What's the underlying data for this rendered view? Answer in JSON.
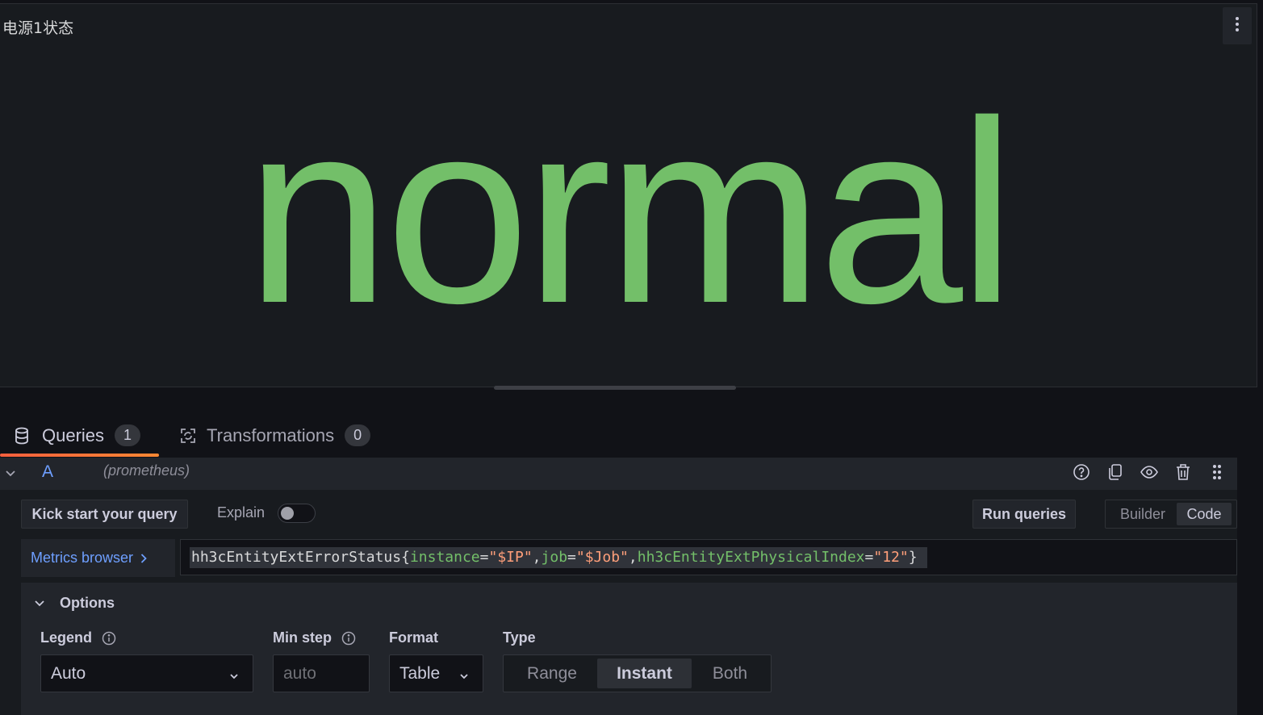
{
  "panel": {
    "title": "电源1状态",
    "value": "normal",
    "value_color": "#73bf69",
    "menu_icon": "kebab-vertical-icon"
  },
  "tabs": [
    {
      "label": "Queries",
      "count": "1",
      "icon": "database-icon",
      "active": true
    },
    {
      "label": "Transformations",
      "count": "0",
      "icon": "transform-icon",
      "active": false
    }
  ],
  "query": {
    "ref_id": "A",
    "datasource": "(prometheus)",
    "actions": [
      "help-icon",
      "duplicate-icon",
      "eye-icon",
      "trash-icon",
      "drag-handle-icon"
    ],
    "kick_start_label": "Kick start your query",
    "explain_label": "Explain",
    "explain_on": false,
    "run_label": "Run queries",
    "mode_builder": "Builder",
    "mode_code": "Code",
    "mode_selected": "Code",
    "metrics_browser_label": "Metrics browser",
    "expr": {
      "metric": "hh3cEntityExtErrorStatus",
      "open": "{",
      "close": "}",
      "labels": [
        {
          "name": "instance",
          "value": "\"$IP\""
        },
        {
          "name": "job",
          "value": "\"$Job\""
        },
        {
          "name": "hh3cEntityExtPhysicalIndex",
          "value": "\"12\""
        }
      ]
    }
  },
  "options": {
    "title": "Options",
    "legend_label": "Legend",
    "legend_value": "Auto",
    "min_step_label": "Min step",
    "min_step_placeholder": "auto",
    "format_label": "Format",
    "format_value": "Table",
    "type_label": "Type",
    "type_options": [
      "Range",
      "Instant",
      "Both"
    ],
    "type_selected": "Instant"
  }
}
